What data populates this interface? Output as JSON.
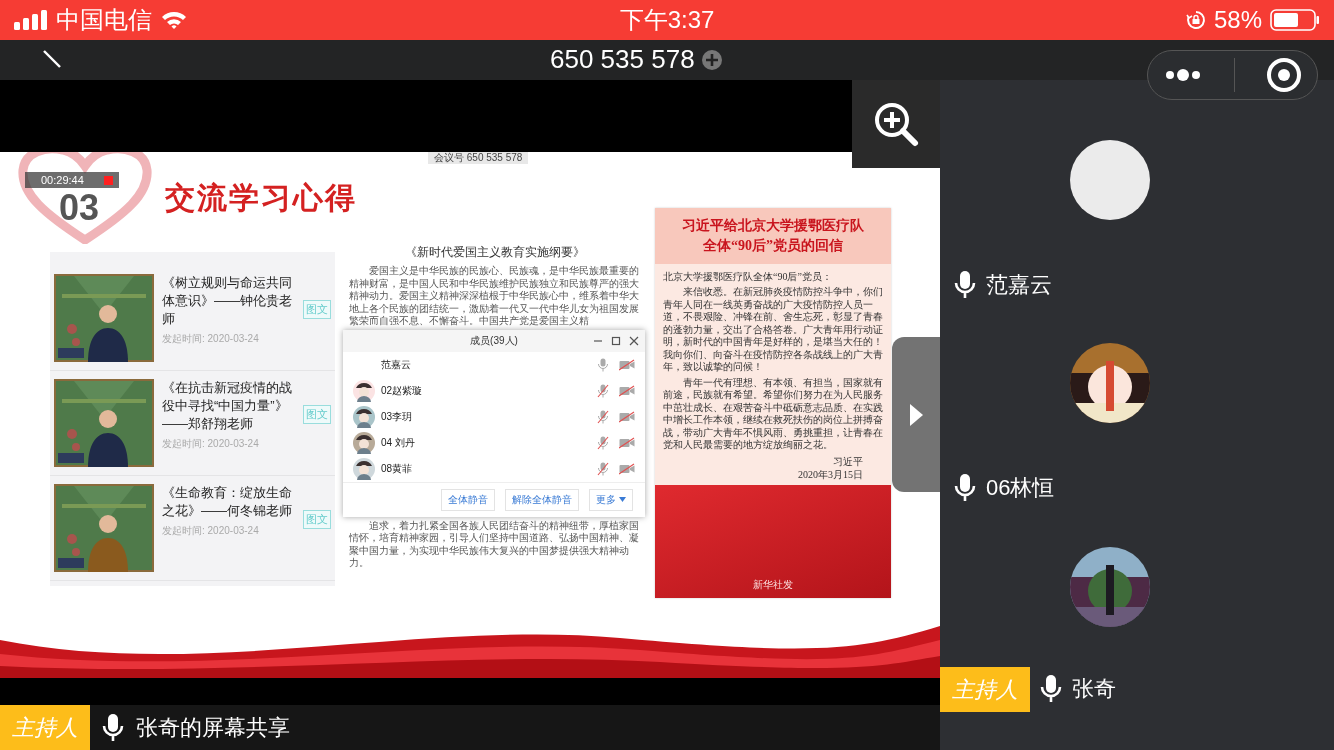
{
  "status_bar": {
    "carrier": "中国电信",
    "time": "下午3:37",
    "battery": "58%"
  },
  "nav": {
    "title": "650 535 578"
  },
  "shared_screen": {
    "meeting_id": "会议号 650 535 578",
    "timer": "00:29:44",
    "section_number": "03",
    "slide_title": "交流学习心得",
    "courses": [
      {
        "title": "《树立规则与命运共同体意识》——钟伦贵老师",
        "tag": "图文",
        "date": "发起时间: 2020-03-24"
      },
      {
        "title": "《在抗击新冠疫情的战役中寻找“中国力量”》——郑舒翔老师",
        "tag": "图文",
        "date": "发起时间: 2020-03-24"
      },
      {
        "title": "《生命教育：绽放生命之花》——何冬锦老师",
        "tag": "图文",
        "date": "发起时间: 2020-03-24"
      }
    ],
    "article": {
      "title": "《新时代爱国主义教育实施纲要》",
      "paragraphs": [
        "爱国主义是中华民族的民族心、民族魂，是中华民族最重要的精神财富，是中国人民和中华民族维护民族独立和民族尊严的强大精神动力。爱国主义精神深深植根于中华民族心中，维系着中华大地上各个民族的团结统一，激励着一代又一代中华儿女为祖国发展繁荣而自强不息、不懈奋斗。中国共产党是爱国主义精",
        "追求，着力扎紧全国各族人民团结奋斗的精神纽带，厚植家国情怀，培育精神家园，引导人们坚持中国道路、弘扬中国精神、凝聚中国力量，为实现中华民族伟大复兴的中国梦提供强大精神动力。"
      ]
    },
    "members_dialog": {
      "title": "成员(39人)",
      "members": [
        {
          "name": "范嘉云",
          "has_avatar": false,
          "mic_muted": false,
          "camera_off": true
        },
        {
          "name": "02赵紫璇",
          "has_avatar": true,
          "mic_muted": true,
          "camera_off": true
        },
        {
          "name": "03李玥",
          "has_avatar": true,
          "mic_muted": true,
          "camera_off": true
        },
        {
          "name": "04 刘丹",
          "has_avatar": true,
          "mic_muted": true,
          "camera_off": true
        },
        {
          "name": "08黄菲",
          "has_avatar": true,
          "mic_muted": true,
          "camera_off": true
        }
      ],
      "buttons": [
        "全体静音",
        "解除全体静音",
        "更多"
      ]
    },
    "letter": {
      "title_lines": [
        "习近平给北京大学援鄂医疗队",
        "全体“90后”党员的回信"
      ],
      "salutation": "北京大学援鄂医疗队全体“90后”党员：",
      "paragraphs": [
        "来信收悉。在新冠肺炎疫情防控斗争中，你们青年人同在一线英勇奋战的广大疫情防控人员一道，不畏艰险、冲锋在前、舍生忘死，彰显了青春的蓬勃力量，交出了合格答卷。广大青年用行动证明，新时代的中国青年是好样的，是堪当大任的！我向你们、向奋斗在疫情防控各条战线上的广大青年，致以诚挚的问候！",
        "青年一代有理想、有本领、有担当，国家就有前途，民族就有希望。希望你们努力在为人民服务中茁壮成长、在艰苦奋斗中砥砺意志品质、在实践中增长工作本领，继续在救死扶伤的岗位上拼搏奋战，带动广大青年不惧风雨、勇挑重担，让青春在党和人民最需要的地方绽放绚丽之花。"
      ],
      "signature": "习近平",
      "date": "2020年3月15日",
      "footer": "新华社发"
    }
  },
  "presenter_bar": {
    "role": "主持人",
    "label": "张奇的屏幕共享"
  },
  "participants": [
    {
      "name": "范嘉云",
      "kind": "blank"
    },
    {
      "name": "06林恒",
      "kind": "picture"
    },
    {
      "name": "张奇",
      "kind": "picture",
      "role": "主持人"
    }
  ]
}
